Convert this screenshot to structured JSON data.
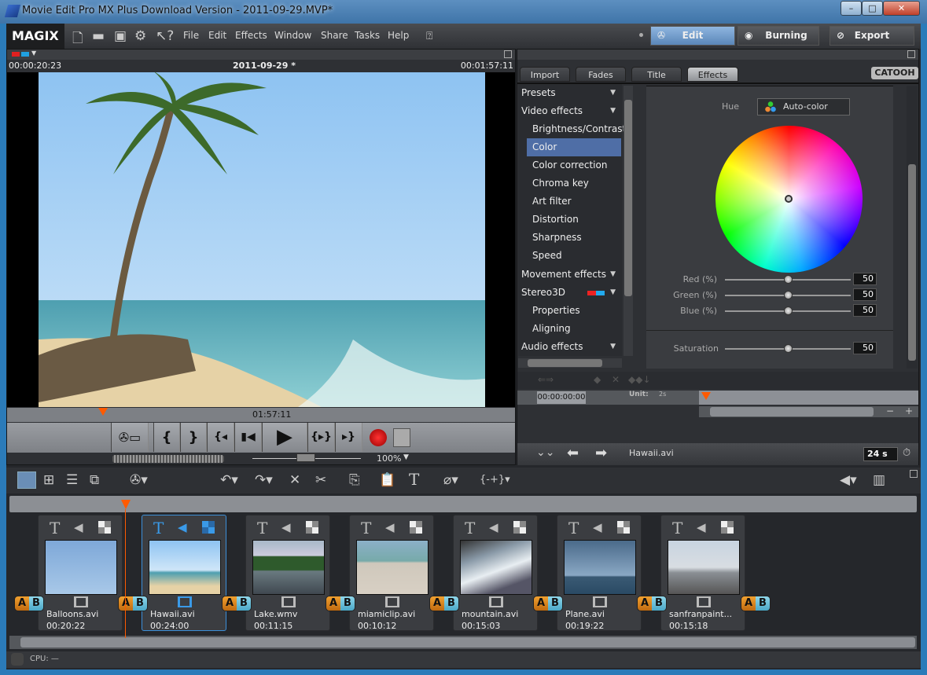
{
  "window": {
    "title": "Movie Edit Pro MX Plus Download Version - 2011-09-29.MVP*",
    "minimize": "–",
    "maximize": "□",
    "close": "✕"
  },
  "menubar": {
    "logo": "MAGIX",
    "menus": [
      "File",
      "Edit",
      "Effects",
      "Window",
      "Share",
      "Tasks",
      "Help"
    ],
    "modes": {
      "edit": "Edit",
      "burning": "Burning",
      "export": "Export"
    }
  },
  "monitor": {
    "current_time": "00:00:20:23",
    "project_name": "2011-09-29 *",
    "total_time": "00:01:57:11",
    "ruler_time": "01:57:11",
    "zoom": "100%",
    "transport": [
      "{",
      "}",
      "{◂",
      "▮◀",
      "▶",
      "{▸}",
      "▸}"
    ]
  },
  "media_pool": {
    "tabs": [
      "Import",
      "Fades",
      "Title",
      "Effects"
    ],
    "active_tab": "Effects",
    "brand": "CATOOH",
    "tree": [
      {
        "label": "Presets",
        "level": 0,
        "expandable": true
      },
      {
        "label": "Video effects",
        "level": 0,
        "expandable": true
      },
      {
        "label": "Brightness/Contrast",
        "level": 1
      },
      {
        "label": "Color",
        "level": 1,
        "selected": true
      },
      {
        "label": "Color correction",
        "level": 1
      },
      {
        "label": "Chroma key",
        "level": 1
      },
      {
        "label": "Art filter",
        "level": 1
      },
      {
        "label": "Distortion",
        "level": 1
      },
      {
        "label": "Sharpness",
        "level": 1
      },
      {
        "label": "Speed",
        "level": 1
      },
      {
        "label": "Movement effects",
        "level": 0,
        "expandable": true
      },
      {
        "label": "Stereo3D",
        "level": 0,
        "expandable": true
      },
      {
        "label": "Properties",
        "level": 1
      },
      {
        "label": "Aligning",
        "level": 1
      },
      {
        "label": "Audio effects",
        "level": 0,
        "expandable": true
      }
    ],
    "color": {
      "hue_label": "Hue",
      "auto_color": "Auto-color",
      "sliders": [
        {
          "label": "Red (%)",
          "value": 50
        },
        {
          "label": "Green (%)",
          "value": 50
        },
        {
          "label": "Blue (%)",
          "value": 50
        }
      ],
      "saturation": {
        "label": "Saturation",
        "value": 50
      }
    },
    "keyframes": {
      "time": "00:00:00:00",
      "unit_label": "Unit:",
      "unit_value": "2s"
    },
    "footer": {
      "clip_name": "Hawaii.avi",
      "duration": "24 s"
    }
  },
  "storyboard": {
    "clips": [
      {
        "name": "Balloons.avi",
        "duration": "00:20:22"
      },
      {
        "name": "Hawaii.avi",
        "duration": "00:24:00",
        "selected": true
      },
      {
        "name": "Lake.wmv",
        "duration": "00:11:15"
      },
      {
        "name": "miamiclip.avi",
        "duration": "00:10:12"
      },
      {
        "name": "mountain.avi",
        "duration": "00:15:03"
      },
      {
        "name": "Plane.avi",
        "duration": "00:19:22"
      },
      {
        "name": "sanfranpaint...",
        "duration": "00:15:18"
      }
    ],
    "transition_label_a": "A",
    "transition_label_b": "B"
  },
  "status": {
    "cpu": "CPU: —"
  }
}
